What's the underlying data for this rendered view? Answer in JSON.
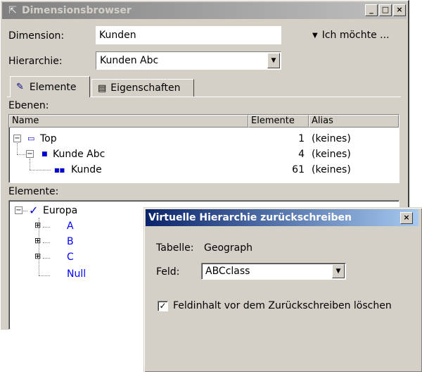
{
  "main_window": {
    "title": "Dimensionsbrowser",
    "minimize": "_",
    "maximize": "□",
    "close": "×",
    "dimension_label": "Dimension:",
    "dimension_value": "Kunden",
    "menu_label": "Ich möchte ...",
    "hierarchy_label": "Hierarchie:",
    "hierarchy_value": "Kunden Abc",
    "tabs": [
      {
        "label": "Elemente",
        "active": true
      },
      {
        "label": "Eigenschaften",
        "active": false
      }
    ],
    "levels": {
      "label": "Ebenen:",
      "columns": [
        "Name",
        "Elemente",
        "Alias"
      ],
      "rows": [
        {
          "name": "Top",
          "count": "1",
          "alias": "(keines)"
        },
        {
          "name": "Kunde Abc",
          "count": "4",
          "alias": "(keines)"
        },
        {
          "name": "Kunde",
          "count": "61",
          "alias": "(keines)"
        }
      ]
    },
    "elements": {
      "label": "Elemente:",
      "root": "Europa",
      "children": [
        "A",
        "B",
        "C",
        "Null"
      ]
    }
  },
  "dialog": {
    "title": "Virtuelle Hierarchie zurückschreiben",
    "close": "×",
    "table_label": "Tabelle:",
    "table_value": "Geograph",
    "field_label": "Feld:",
    "field_value": "ABCclass",
    "checkbox_label": "Feldinhalt vor dem Zurückschreiben löschen",
    "checkbox_checked": true
  },
  "colors": {
    "window_bg": "#d4d0c8",
    "active_title": "#0a246a",
    "inactive_title": "#808080",
    "link_blue": "#0000ff"
  }
}
